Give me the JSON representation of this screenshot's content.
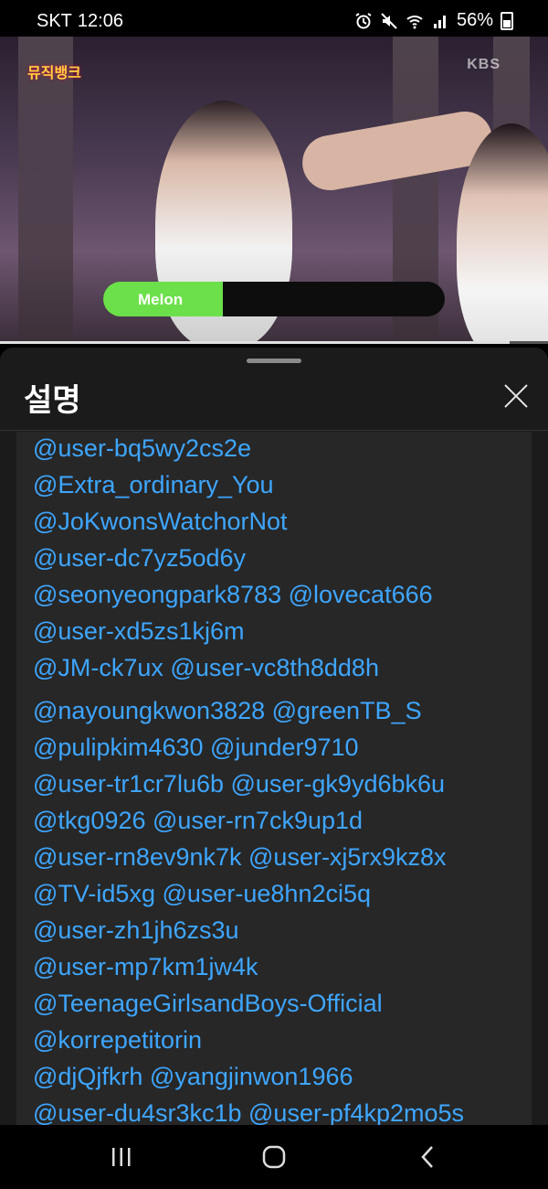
{
  "status_bar": {
    "carrier": "SKT",
    "time": "12:06",
    "battery": "56%",
    "icons": [
      "alarm-icon",
      "mute-icon",
      "wifi-icon",
      "signal-icon",
      "battery-icon"
    ]
  },
  "video": {
    "show_logo": "뮤직뱅크",
    "channel": "KBS",
    "vote_bar": {
      "label": "Melon",
      "fill_percent": 35,
      "color": "#6ce04a"
    },
    "progress_fraction": 0.93
  },
  "sheet": {
    "title": "설명",
    "close_icon": "close-icon"
  },
  "mentions": [
    "@user-bq5wy2cs2e",
    "@Extra_ordinary_You",
    "@JoKwonsWatchorNot",
    "@user-dc7yz5od6y",
    "@seonyeongpark8783 @lovecat666",
    "@user-xd5zs1kj6m",
    "@JM-ck7ux @user-vc8th8dd8h"
  ],
  "mentions2": [
    "@nayoungkwon3828 @greenTB_S",
    "@pulipkim4630 @junder9710",
    "@user-tr1cr7lu6b @user-gk9yd6bk6u",
    "@tkg0926 @user-rn7ck9up1d",
    "@user-rn8ev9nk7k @user-xj5rx9kz8x",
    "@TV-id5xg @user-ue8hn2ci5q",
    "@user-zh1jh6zs3u",
    "@user-mp7km1jw4k",
    "@TeenageGirlsandBoys-Official",
    "@korrepetitorin",
    "@djQjfkrh @yangjinwon1966",
    "@user-du4sr3kc1b @user-pf4kp2mo5s"
  ],
  "nav": {
    "recent": "recent-apps-icon",
    "home": "home-icon",
    "back": "back-icon"
  }
}
